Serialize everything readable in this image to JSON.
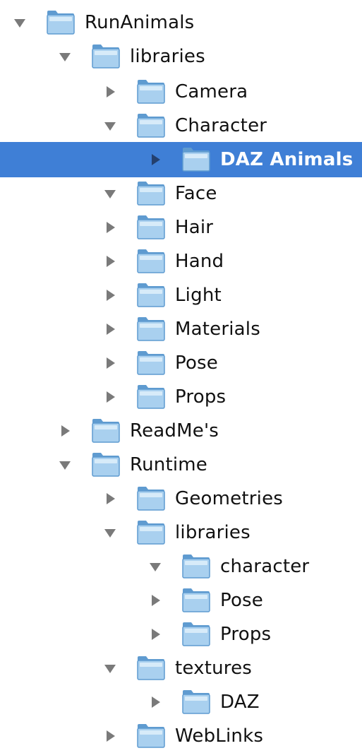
{
  "colors": {
    "selection": "#3f7fd6",
    "triangle": "#7a7a7a",
    "triangle_selected": "#24406e",
    "folder_fill": "#a9d0ef",
    "folder_stroke": "#5f9bd0",
    "text": "#111111",
    "text_selected": "#ffffff"
  },
  "tree": {
    "items": [
      {
        "label": "RunAnimals",
        "depth": 0,
        "expanded": true,
        "selected": false,
        "icon": "folder-icon"
      },
      {
        "label": "libraries",
        "depth": 1,
        "expanded": true,
        "selected": false,
        "icon": "folder-icon"
      },
      {
        "label": "Camera",
        "depth": 2,
        "expanded": false,
        "selected": false,
        "icon": "folder-icon"
      },
      {
        "label": "Character",
        "depth": 2,
        "expanded": true,
        "selected": false,
        "icon": "folder-icon"
      },
      {
        "label": "DAZ Animals",
        "depth": 3,
        "expanded": false,
        "selected": true,
        "icon": "folder-icon"
      },
      {
        "label": "Face",
        "depth": 2,
        "expanded": true,
        "selected": false,
        "icon": "folder-icon"
      },
      {
        "label": "Hair",
        "depth": 2,
        "expanded": false,
        "selected": false,
        "icon": "folder-icon"
      },
      {
        "label": "Hand",
        "depth": 2,
        "expanded": false,
        "selected": false,
        "icon": "folder-icon"
      },
      {
        "label": "Light",
        "depth": 2,
        "expanded": false,
        "selected": false,
        "icon": "folder-icon"
      },
      {
        "label": "Materials",
        "depth": 2,
        "expanded": false,
        "selected": false,
        "icon": "folder-icon"
      },
      {
        "label": "Pose",
        "depth": 2,
        "expanded": false,
        "selected": false,
        "icon": "folder-icon"
      },
      {
        "label": "Props",
        "depth": 2,
        "expanded": false,
        "selected": false,
        "icon": "folder-icon"
      },
      {
        "label": "ReadMe's",
        "depth": 1,
        "expanded": false,
        "selected": false,
        "icon": "folder-icon"
      },
      {
        "label": "Runtime",
        "depth": 1,
        "expanded": true,
        "selected": false,
        "icon": "folder-icon"
      },
      {
        "label": "Geometries",
        "depth": 2,
        "expanded": false,
        "selected": false,
        "icon": "folder-icon"
      },
      {
        "label": "libraries",
        "depth": 2,
        "expanded": true,
        "selected": false,
        "icon": "folder-icon"
      },
      {
        "label": "character",
        "depth": 3,
        "expanded": true,
        "selected": false,
        "icon": "folder-icon"
      },
      {
        "label": "Pose",
        "depth": 3,
        "expanded": false,
        "selected": false,
        "icon": "folder-icon"
      },
      {
        "label": "Props",
        "depth": 3,
        "expanded": false,
        "selected": false,
        "icon": "folder-icon"
      },
      {
        "label": "textures",
        "depth": 2,
        "expanded": true,
        "selected": false,
        "icon": "folder-icon"
      },
      {
        "label": "DAZ",
        "depth": 3,
        "expanded": false,
        "selected": false,
        "icon": "folder-icon"
      },
      {
        "label": "WebLinks",
        "depth": 2,
        "expanded": false,
        "selected": false,
        "icon": "folder-icon"
      }
    ]
  }
}
